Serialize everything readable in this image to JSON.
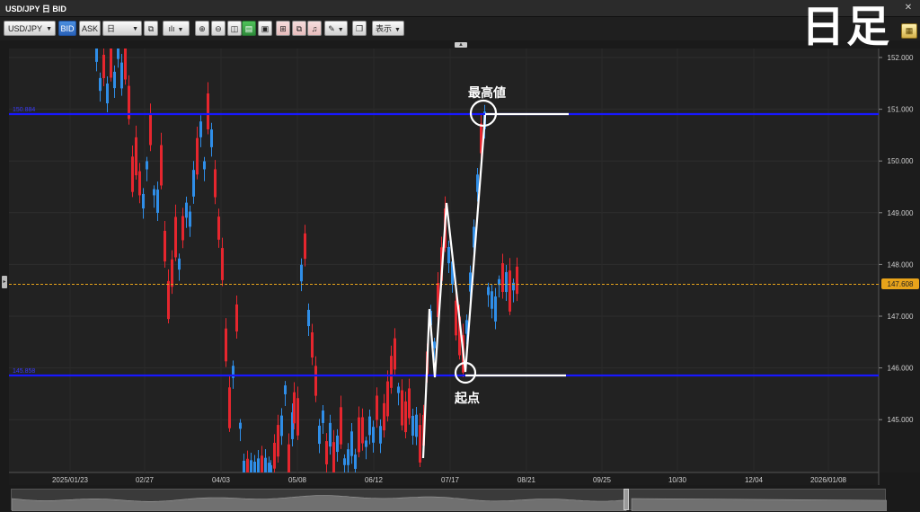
{
  "window": {
    "title": "USD/JPY 日 BID",
    "close_glyph": "✕"
  },
  "toolbar": {
    "symbol": "USD/JPY",
    "bid_label": "BID",
    "ask_label": "ASK",
    "period": "日",
    "display_label": "表示"
  },
  "overlay_label": "日足",
  "chart": {
    "price_labels": [
      "152.000",
      "151.000",
      "150.000",
      "149.000",
      "148.000",
      "147.000",
      "146.000",
      "145.000"
    ],
    "date_labels": [
      "2025/01/23",
      "02/27",
      "04/03",
      "05/08",
      "06/12",
      "07/17",
      "08/21",
      "09/25",
      "10/30",
      "12/04",
      "2026/01/08"
    ],
    "current_price": "147.608",
    "hline_upper_label": "150.884",
    "hline_lower_label": "145.858",
    "annotation_high": "最高値",
    "annotation_start": "起点",
    "colors": {
      "up": "#e6262e",
      "down": "#2f8ee8",
      "hline": "#1a1aff",
      "current": "#e8a31a",
      "annot": "#ffffff"
    }
  },
  "chart_data": {
    "type": "candlestick",
    "title": "USD/JPY 日 BID",
    "ylim": [
      144.15,
      152.15
    ],
    "y_ticks": [
      145,
      146,
      147,
      148,
      149,
      150,
      151,
      152
    ],
    "x_ticks": [
      "2025/01/23",
      "02/27",
      "04/03",
      "05/08",
      "06/12",
      "07/17",
      "08/21",
      "09/25",
      "10/30",
      "12/04",
      "2026/01/08"
    ],
    "current_price": 147.608,
    "horizontal_lines": [
      150.884,
      145.858
    ],
    "annotations": [
      {
        "text": "最高値",
        "price": 150.9
      },
      {
        "text": "起点",
        "price": 145.9
      }
    ]
  }
}
